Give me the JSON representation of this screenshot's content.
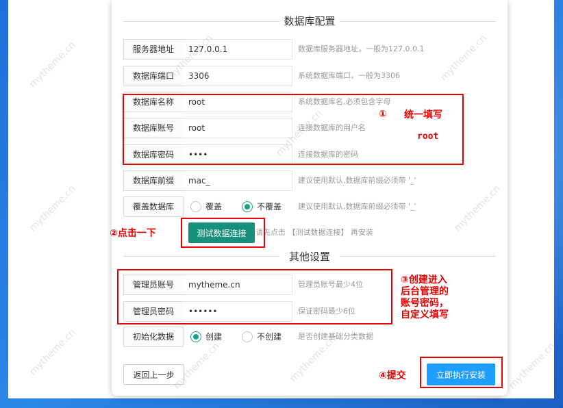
{
  "db_section": {
    "title": "数据库配置",
    "rows": [
      {
        "label": "服务器地址",
        "value": "127.0.0.1",
        "hint": "数据库服务器地址，一般为127.0.0.1"
      },
      {
        "label": "数据库端口",
        "value": "3306",
        "hint": "系统数据库端口，一般为3306"
      },
      {
        "label": "数据库名称",
        "value": "root",
        "hint": "系统数据库名,必须包含字母"
      },
      {
        "label": "数据库账号",
        "value": "root",
        "hint": "连接数据库的用户名"
      },
      {
        "label": "数据库密码",
        "value": "••••",
        "hint": "连接数据库的密码"
      },
      {
        "label": "数据库前缀",
        "value": "mac_",
        "hint": "建议使用默认,数据库前缀必须带 '_'"
      }
    ],
    "overwrite": {
      "label": "覆盖数据库",
      "option_yes": "覆盖",
      "option_no": "不覆盖",
      "selected": "不覆盖",
      "hint": "建议使用默认,数据库前缀必须带 '_'"
    },
    "test_button": "测试数据连接",
    "test_hint": "请先点击 【测试数据连接】 再安装"
  },
  "other_section": {
    "title": "其他设置",
    "admin_account": {
      "label": "管理员账号",
      "value": "mytheme.cn",
      "hint": "管理员账号最少4位"
    },
    "admin_password": {
      "label": "管理员密码",
      "value": "••••••",
      "hint": "保证密码最少6位"
    },
    "init_data": {
      "label": "初始化数据",
      "option_yes": "创建",
      "option_no": "不创建",
      "selected": "创建",
      "hint": "是否创建基础分类数据"
    }
  },
  "buttons": {
    "back": "返回上一步",
    "install": "立即执行安装"
  },
  "annotations": {
    "step1_num": "①",
    "step1_text": "统一填写",
    "step1_sub": "root",
    "step2": "②点击一下",
    "step3_lines": [
      "③创建进入",
      "后台管理的",
      "账号密码，",
      "自定义填写"
    ],
    "step4": "④提交"
  },
  "watermark": "mytheme.cn",
  "colors": {
    "primary_green": "#16907a",
    "primary_blue": "#1e9fff",
    "annotation_red": "#e60000",
    "desktop_blue": "#2a86e8"
  }
}
